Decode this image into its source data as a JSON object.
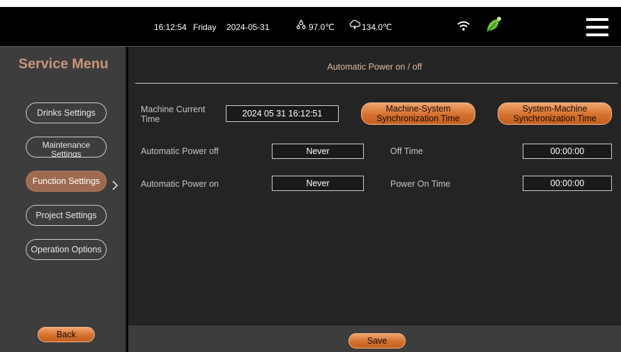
{
  "status": {
    "time": "16:12:54",
    "day": "Friday",
    "date": "2024-05-31",
    "temp1": "97.0℃",
    "temp2": "134.0℃",
    "icons": [
      "water-drops-icon",
      "cloud-icon",
      "wifi-icon",
      "leaf-icon",
      "menu-icon"
    ]
  },
  "sidebar": {
    "title": "Service Menu",
    "items": [
      {
        "label": "Drinks Settings"
      },
      {
        "label": "Maintenance Settings"
      },
      {
        "label": "Function Settings"
      },
      {
        "label": "Project Settings"
      },
      {
        "label": "Operation Options"
      }
    ],
    "back_label": "Back"
  },
  "main": {
    "title": "Automatic Power on / off",
    "machine_time_label": "Machine Current Time",
    "machine_time_value": "2024 05 31 16:12:51",
    "sync_ms_label": "Machine-System Synchronization Time",
    "sync_sm_label": "System-Machine Synchronization Time",
    "power_off_label": "Automatic Power off",
    "power_off_value": "Never",
    "off_time_label": "Off Time",
    "off_time_value": "00:00:00",
    "power_on_label": "Automatic Power on",
    "power_on_value": "Never",
    "on_time_label": "Power On Time",
    "on_time_value": "00:00:00"
  },
  "footer": {
    "save_label": "Save"
  },
  "colors": {
    "accent": "#d5712f",
    "active": "#9e6a50",
    "title": "#c8967a",
    "panel": "#242424",
    "sidebar": "#3d3d3d"
  }
}
